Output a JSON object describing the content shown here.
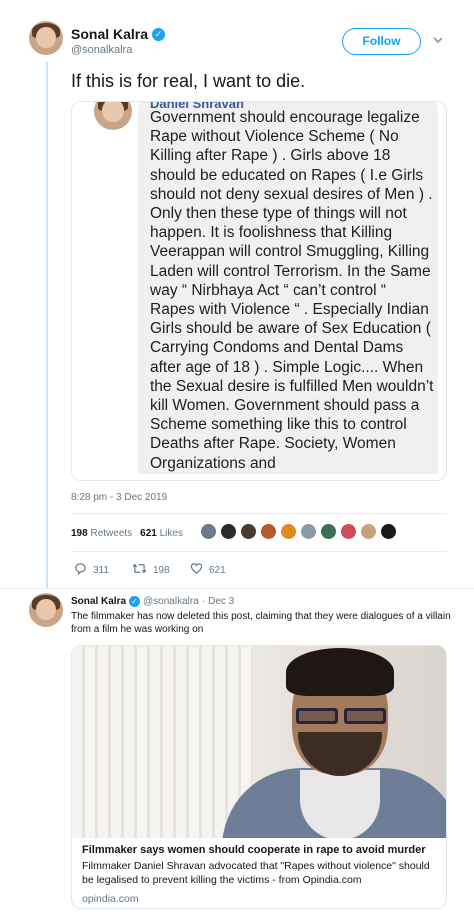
{
  "tweet": {
    "author": {
      "display_name": "Sonal Kalra",
      "handle": "@sonalkalra",
      "verified_icon": "✓"
    },
    "follow_label": "Follow",
    "text": "If this is for real, I want to die.",
    "embedded_post": {
      "poster_name": "Daniel Shravan",
      "text": "Government should encourage legalize Rape without Violence Scheme ( No Killing after Rape ) . Girls above 18 should be educated on Rapes ( I.e Girls should not deny sexual desires of Men ) . Only then these type of things will not happen. It is foolishness that Killing Veerappan will control Smuggling, Killing Laden will control Terrorism. In the Same way “ Nirbhaya Act “ can’t control “ Rapes with Violence “ . Especially Indian Girls should be aware of Sex Education ( Carrying Condoms and Dental Dams after age of 18 ) . Simple Logic.... When the Sexual desire is fulfilled Men wouldn’t kill Women. Government should pass a Scheme something like this to control Deaths after Rape. Society, Women Organizations and"
    },
    "timestamp": "8:28 pm - 3 Dec 2019",
    "retweets_count": "198",
    "retweets_label": "Retweets",
    "likes_count": "621",
    "likes_label": "Likes",
    "liker_colors": [
      "#6b7a8c",
      "#2b2b2b",
      "#4a3a2e",
      "#b55a2a",
      "#e08a1c",
      "#8a9aa8",
      "#3c6e58",
      "#d24b5a",
      "#c5a27a",
      "#1a1a1a"
    ],
    "actions": {
      "reply_count": "311",
      "retweet_count": "198",
      "like_count": "621"
    }
  },
  "reply": {
    "display_name": "Sonal Kalra",
    "verified_icon": "✓",
    "handle": "@sonalkalra",
    "separator": "·",
    "date": "Dec 3",
    "text": "The filmmaker has now deleted this post, claiming that they were dialogues of a villain from a film he was working on",
    "card": {
      "title": "Filmmaker says women should cooperate in rape to avoid murder",
      "description": "Filmmaker Daniel Shravan advocated that \"Rapes without violence\" should be legalised to prevent killing the victims - from Opindia.com",
      "domain": "opindia.com"
    }
  }
}
